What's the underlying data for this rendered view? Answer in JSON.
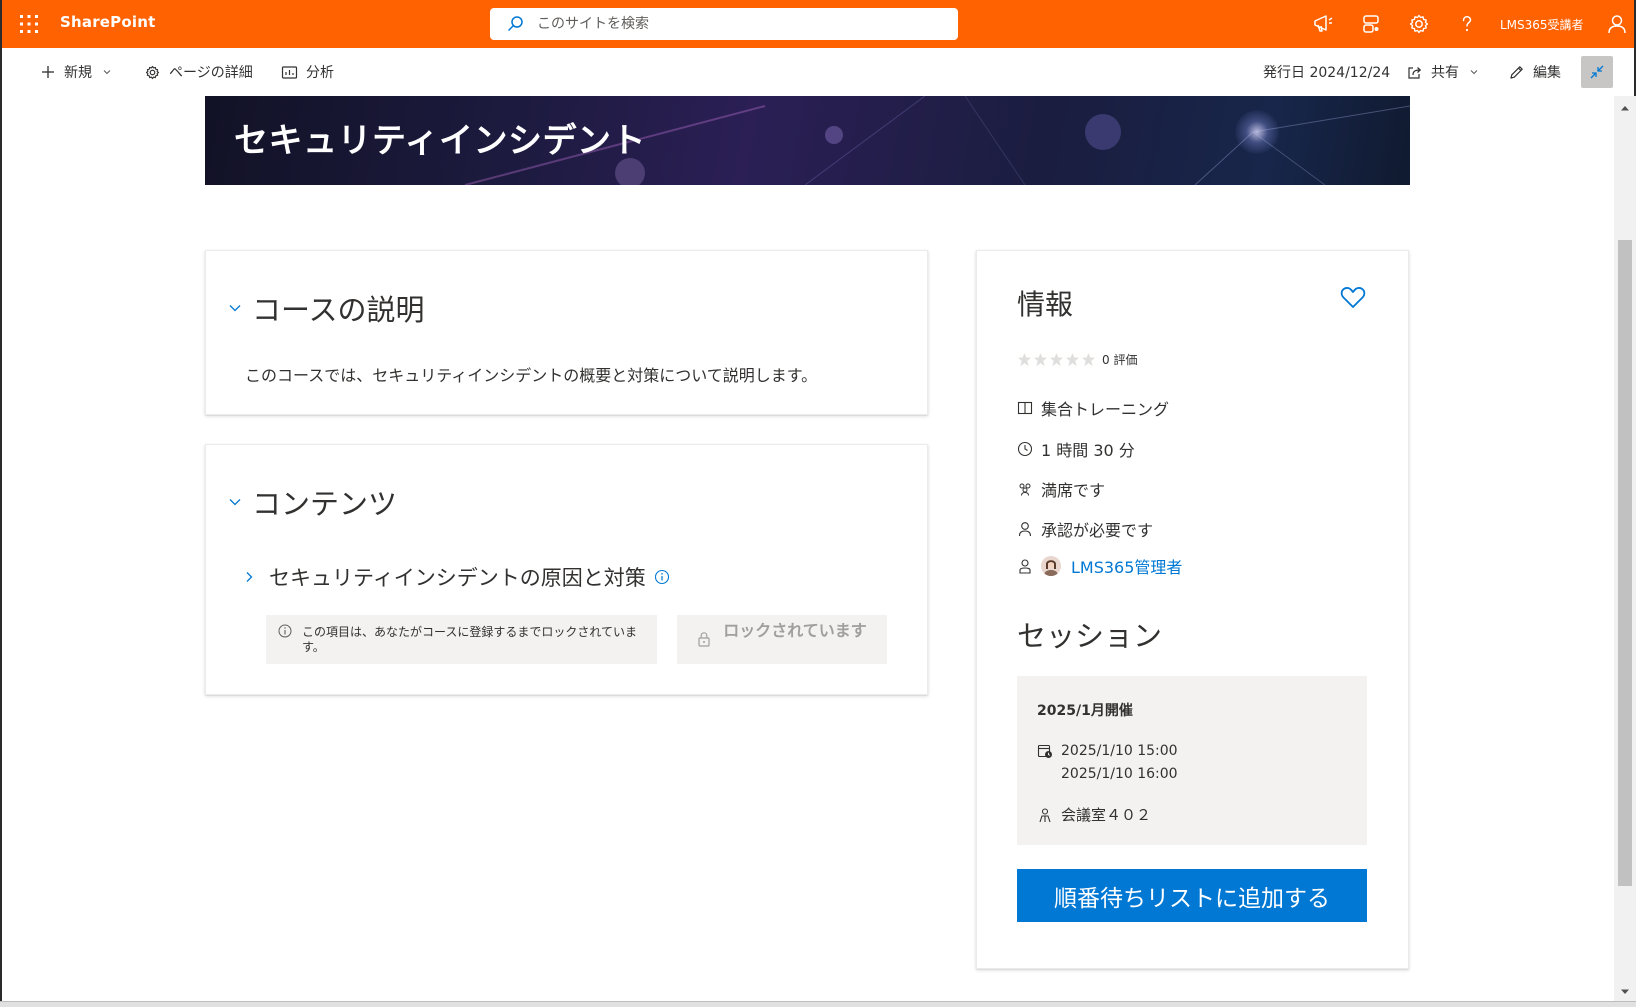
{
  "suite_bar": {
    "brand": "SharePoint",
    "search_placeholder": "このサイトを検索",
    "user_name": "LMS365受講者",
    "accent_color": "#ff6200"
  },
  "command_bar": {
    "new_label": "新規",
    "page_details_label": "ページの詳細",
    "analytics_label": "分析",
    "published": "発行日 2024/12/24",
    "share_label": "共有",
    "edit_label": "編集"
  },
  "hero": {
    "title": "セキュリティインシデント"
  },
  "description_section": {
    "title": "コースの説明",
    "text": "このコースでは、セキュリティインシデントの概要と対策について説明します。"
  },
  "contents_section": {
    "title": "コンテンツ",
    "items": [
      {
        "title": "セキュリティインシデントの原因と対策",
        "lock_note": "この項目は、あなたがコースに登録するまでロックされています。",
        "lock_button": "ロックされています"
      }
    ]
  },
  "info_panel": {
    "title": "情報",
    "rating_value": 0,
    "rating_max": 5,
    "rating_text": "0 評価",
    "training_type": "集合トレーニング",
    "duration": "1 時間 30 分",
    "seats": "満席です",
    "approval": "承認が必要です",
    "owner": "LMS365管理者",
    "sessions_title": "セッション",
    "session": {
      "name": "2025/1月開催",
      "start": "2025/1/10 15:00",
      "end": "2025/1/10 16:00",
      "location": "会議室４０２"
    },
    "waitlist_button": "順番待ちリストに追加する",
    "button_color": "#0078d4"
  }
}
